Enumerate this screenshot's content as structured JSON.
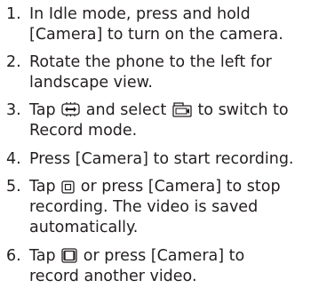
{
  "steps": [
    {
      "number": "1.",
      "line1": "In Idle mode, press and hold",
      "line2": "[Camera] to turn on the camera."
    },
    {
      "number": "2.",
      "line1": "Rotate the phone to the left for",
      "line2": "landscape view."
    },
    {
      "number": "3.",
      "line1_a": "Tap",
      "line1_b": "and select",
      "line1_c": "to switch to",
      "line2": "Record mode.",
      "icons": [
        "mode-switch-icon",
        "video-camera-icon"
      ]
    },
    {
      "number": "4.",
      "line1": "Press [Camera] to start recording."
    },
    {
      "number": "5.",
      "line1_a": "Tap",
      "line1_b": "or press [Camera] to stop",
      "line2": "recording. The video is saved",
      "line3": "automatically.",
      "icons": [
        "stop-icon"
      ]
    },
    {
      "number": "6.",
      "line1_a": "Tap",
      "line1_b": "or press [Camera] to",
      "line2": "record another video.",
      "icons": [
        "new-video-icon"
      ]
    }
  ]
}
